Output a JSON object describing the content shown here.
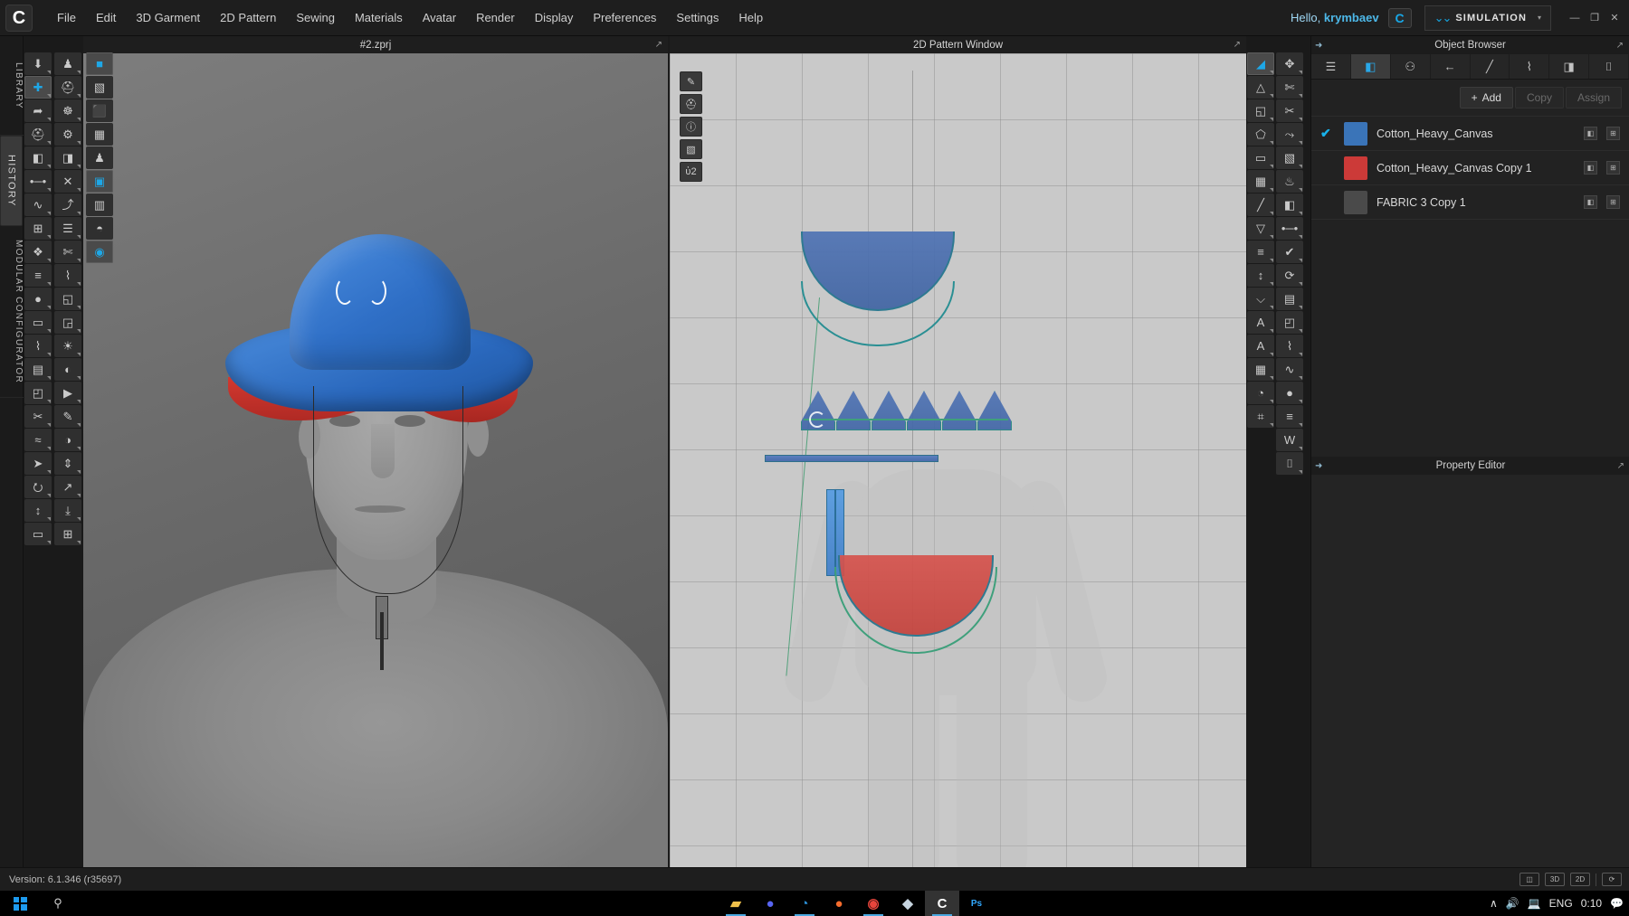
{
  "app": {
    "logo_glyph": "C",
    "greeting_prefix": "Hello, ",
    "greeting_user": "krymbaev",
    "cloud_glyph": "C",
    "mode_label": "SIMULATION",
    "mode_chevron": "⌄⌄",
    "mode_arrow": "▾"
  },
  "menu": {
    "items": [
      {
        "label": "File"
      },
      {
        "label": "Edit"
      },
      {
        "label": "3D Garment"
      },
      {
        "label": "2D Pattern"
      },
      {
        "label": "Sewing"
      },
      {
        "label": "Materials"
      },
      {
        "label": "Avatar"
      },
      {
        "label": "Render"
      },
      {
        "label": "Display"
      },
      {
        "label": "Preferences"
      },
      {
        "label": "Settings"
      },
      {
        "label": "Help"
      }
    ]
  },
  "window_controls": {
    "minimize": "—",
    "restore": "❐",
    "close": "✕"
  },
  "left_tabs": {
    "library": "LIBRARY",
    "history": "HISTORY",
    "modular_configurator": "MODULAR CONFIGURATOR"
  },
  "viewport_3d": {
    "title": "#2.zprj",
    "popout_icon": "↗",
    "hat_logo_text": ""
  },
  "viewport_2d": {
    "title": "2D Pattern Window",
    "popout_icon": "↗"
  },
  "tools_3d": {
    "column_a": [
      {
        "name": "transform-pattern-tool",
        "glyph": "⬇",
        "active": false,
        "accent": false
      },
      {
        "name": "move-tool",
        "glyph": "✚",
        "active": true,
        "accent": true
      },
      {
        "name": "select-mesh-tool",
        "glyph": "➦",
        "active": false,
        "accent": false
      },
      {
        "name": "fold-arrangement-tool",
        "glyph": "⛑",
        "active": false,
        "accent": false
      },
      {
        "name": "segment-sewing-tool",
        "glyph": "◧",
        "active": false,
        "accent": false
      },
      {
        "name": "free-sewing-tool",
        "glyph": "•─•",
        "active": false,
        "accent": false
      },
      {
        "name": "edit-sewing-tool",
        "glyph": "∿",
        "active": false,
        "accent": false
      },
      {
        "name": "pin-tool",
        "glyph": "⊞",
        "active": false,
        "accent": false
      },
      {
        "name": "tack-tool",
        "glyph": "❖",
        "active": false,
        "accent": false
      },
      {
        "name": "zipper-tool",
        "glyph": "≡",
        "active": false,
        "accent": false
      },
      {
        "name": "button-tool",
        "glyph": "●",
        "active": false,
        "accent": false
      },
      {
        "name": "buttonhole-tool",
        "glyph": "▭",
        "active": false,
        "accent": false
      },
      {
        "name": "topstitch-tool",
        "glyph": "⌇",
        "active": false,
        "accent": false
      },
      {
        "name": "fabric-texture-tool",
        "glyph": "▤",
        "active": false,
        "accent": false
      },
      {
        "name": "graphic-tool",
        "glyph": "◰",
        "active": false,
        "accent": false
      },
      {
        "name": "trim-tool",
        "glyph": "✂",
        "active": false,
        "accent": false
      },
      {
        "name": "puckering-tool",
        "glyph": "≈",
        "active": false,
        "accent": false
      },
      {
        "name": "measure-tool",
        "glyph": "➤",
        "active": false,
        "accent": false
      },
      {
        "name": "circumference-tool",
        "glyph": "⭮",
        "active": false,
        "accent": false
      },
      {
        "name": "gravity-tool",
        "glyph": "↕",
        "active": false,
        "accent": false
      },
      {
        "name": "flatten-tool",
        "glyph": "▭",
        "active": false,
        "accent": false
      }
    ],
    "column_b": [
      {
        "name": "avatar-pose-tool",
        "glyph": "♟",
        "active": false,
        "accent": false
      },
      {
        "name": "garment-fit-tool",
        "glyph": "⛑",
        "active": false,
        "accent": false
      },
      {
        "name": "xray-joints-tool",
        "glyph": "☸",
        "active": false,
        "accent": false
      },
      {
        "name": "pin-avatar-tool",
        "glyph": "⚙",
        "active": false,
        "accent": false
      },
      {
        "name": "layer-tool",
        "glyph": "◨",
        "active": false,
        "accent": false
      },
      {
        "name": "strength-map-tool",
        "glyph": "✕",
        "active": false,
        "accent": false
      },
      {
        "name": "fold-tool",
        "glyph": "⤴",
        "active": false,
        "accent": false
      },
      {
        "name": "print-layout-tool",
        "glyph": "☰",
        "active": false,
        "accent": false
      },
      {
        "name": "scissors-tool",
        "glyph": "✄",
        "active": false,
        "accent": false
      },
      {
        "name": "stitch-tool",
        "glyph": "⌇",
        "active": false,
        "accent": false
      },
      {
        "name": "snapshot-tool",
        "glyph": "◱",
        "active": false,
        "accent": false
      },
      {
        "name": "camera-tool",
        "glyph": "◲",
        "active": false,
        "accent": false
      },
      {
        "name": "light-tool",
        "glyph": "☀",
        "active": false,
        "accent": false
      },
      {
        "name": "render-tool",
        "glyph": "◐",
        "active": false,
        "accent": false
      },
      {
        "name": "animation-tool",
        "glyph": "▶",
        "active": false,
        "accent": false
      },
      {
        "name": "texture-paint-tool",
        "glyph": "✎",
        "active": false,
        "accent": false
      },
      {
        "name": "color-tool",
        "glyph": "◑",
        "active": false,
        "accent": false
      },
      {
        "name": "measure-avatar-tool",
        "glyph": "⇕",
        "active": false,
        "accent": false
      },
      {
        "name": "vector-tool",
        "glyph": "↗",
        "active": false,
        "accent": false
      },
      {
        "name": "export-tool",
        "glyph": "⤓",
        "active": false,
        "accent": false
      },
      {
        "name": "grade-tool",
        "glyph": "⊞",
        "active": false,
        "accent": false
      }
    ],
    "column_c": [
      {
        "name": "fabric-preview-swatch",
        "glyph": "■",
        "active": true,
        "accent": true
      },
      {
        "name": "shading-mode-button",
        "glyph": "▧",
        "active": false,
        "accent": false
      },
      {
        "name": "thickness-view-button",
        "glyph": "⬛",
        "active": false,
        "accent": false
      },
      {
        "name": "texture-view-button",
        "glyph": "▦",
        "active": false,
        "accent": false
      },
      {
        "name": "avatar-view-button",
        "glyph": "♟",
        "active": false,
        "accent": false
      },
      {
        "name": "surface-view-button",
        "glyph": "▣",
        "active": true,
        "accent": true
      },
      {
        "name": "mesh-view-button",
        "glyph": "▥",
        "active": false,
        "accent": false
      },
      {
        "name": "shadow-view-button",
        "glyph": "◓",
        "active": false,
        "accent": false
      },
      {
        "name": "render-view-button",
        "glyph": "◉",
        "active": true,
        "accent": true
      }
    ]
  },
  "tools_2d_floating": [
    {
      "name": "edit-pattern-tool",
      "glyph": "✎"
    },
    {
      "name": "show-pattern-outline-tool",
      "glyph": "⛑"
    },
    {
      "name": "show-pattern-info-tool",
      "glyph": "ⓘ"
    },
    {
      "name": "show-texture-tool",
      "glyph": "▧"
    },
    {
      "name": "lock-pattern-tool",
      "glyph": "ὑ2"
    }
  ],
  "tools_2d_right": {
    "column_a": [
      {
        "name": "edit-pattern-select-tool",
        "glyph": "◢",
        "active": true,
        "accent": true
      },
      {
        "name": "edit-curve-point-tool",
        "glyph": "△",
        "active": false,
        "accent": false
      },
      {
        "name": "edit-curvature-tool",
        "glyph": "◱",
        "active": false,
        "accent": false
      },
      {
        "name": "create-polygon-tool",
        "glyph": "⬠",
        "active": false,
        "accent": false
      },
      {
        "name": "create-rectangle-tool",
        "glyph": "▭",
        "active": false,
        "accent": false
      },
      {
        "name": "trace-tool",
        "glyph": "▦",
        "active": false,
        "accent": false
      },
      {
        "name": "internal-line-tool",
        "glyph": "╱",
        "active": false,
        "accent": false
      },
      {
        "name": "dart-tool",
        "glyph": "▽",
        "active": false,
        "accent": false
      },
      {
        "name": "pleat-tool",
        "glyph": "≡",
        "active": false,
        "accent": false
      },
      {
        "name": "grainline-tool",
        "glyph": "↕",
        "active": false,
        "accent": false
      },
      {
        "name": "notch-tool",
        "glyph": "⌵",
        "active": false,
        "accent": false
      },
      {
        "name": "text-tool",
        "glyph": "A",
        "active": false,
        "accent": false
      },
      {
        "name": "annotation-tool",
        "glyph": "A",
        "active": false,
        "accent": false
      },
      {
        "name": "fabric-grid-tool",
        "glyph": "▦",
        "active": false,
        "accent": false
      },
      {
        "name": "pattern-3d-tool",
        "glyph": "◔",
        "active": false,
        "accent": false
      },
      {
        "name": "measure-2d-tool",
        "glyph": "⌗",
        "active": false,
        "accent": false
      }
    ],
    "column_b": [
      {
        "name": "move-pattern-tool",
        "glyph": "✥",
        "active": false,
        "accent": false
      },
      {
        "name": "cut-sew-tool",
        "glyph": "✄",
        "active": false,
        "accent": false
      },
      {
        "name": "slash-spread-tool",
        "glyph": "✂",
        "active": false,
        "accent": false
      },
      {
        "name": "fold-seam-tool",
        "glyph": "⤳",
        "active": false,
        "accent": false
      },
      {
        "name": "seam-allowance-tool",
        "glyph": "▧",
        "active": false,
        "accent": false
      },
      {
        "name": "iron-tool",
        "glyph": "♨",
        "active": false,
        "accent": false
      },
      {
        "name": "segment-sewing-2d-tool",
        "glyph": "◧",
        "active": false,
        "accent": false
      },
      {
        "name": "free-sewing-2d-tool",
        "glyph": "•─•",
        "active": false,
        "accent": false
      },
      {
        "name": "check-sewing-tool",
        "glyph": "✔",
        "active": false,
        "accent": false
      },
      {
        "name": "auto-sewing-tool",
        "glyph": "⟳",
        "active": false,
        "accent": false
      },
      {
        "name": "texture-2d-tool",
        "glyph": "▤",
        "active": false,
        "accent": false
      },
      {
        "name": "graphic-2d-tool",
        "glyph": "◰",
        "active": false,
        "accent": false
      },
      {
        "name": "stitch-2d-tool",
        "glyph": "⌇",
        "active": false,
        "accent": false
      },
      {
        "name": "topstitch-2d-tool",
        "glyph": "∿",
        "active": false,
        "accent": false
      },
      {
        "name": "button-2d-tool",
        "glyph": "●",
        "active": false,
        "accent": false
      },
      {
        "name": "zipper-2d-tool",
        "glyph": "≡",
        "active": false,
        "accent": false
      },
      {
        "name": "grade-rule-tool",
        "glyph": "W",
        "active": false,
        "accent": false
      },
      {
        "name": "ruler-tool",
        "glyph": "⌷",
        "active": false,
        "accent": false
      }
    ]
  },
  "object_browser": {
    "title": "Object Browser",
    "pin_icon": "➜",
    "popout_icon": "↗",
    "tabs": [
      {
        "name": "tab-list-view",
        "icon": "☰",
        "selected": false
      },
      {
        "name": "tab-fabric",
        "icon": "◧",
        "selected": true
      },
      {
        "name": "tab-button",
        "icon": "⚇",
        "selected": false
      },
      {
        "name": "tab-zipper",
        "icon": "←",
        "selected": false
      },
      {
        "name": "tab-topstitch",
        "icon": "╱",
        "selected": false
      },
      {
        "name": "tab-stitch",
        "icon": "⌇",
        "selected": false
      },
      {
        "name": "tab-trim",
        "icon": "◨",
        "selected": false
      },
      {
        "name": "tab-measure",
        "icon": "⌷",
        "selected": false
      }
    ],
    "actions": {
      "add_label": "Add",
      "add_icon": "+",
      "copy_label": "Copy",
      "assign_label": "Assign"
    },
    "items": [
      {
        "name": "Cotton_Heavy_Canvas",
        "color": "#3a74b8",
        "checked": true,
        "check_glyph": "✔",
        "mini_icons": [
          "◧",
          "⊞"
        ]
      },
      {
        "name": "Cotton_Heavy_Canvas Copy 1",
        "color": "#cc3a38",
        "checked": false,
        "check_glyph": "",
        "mini_icons": [
          "◧",
          "⊞"
        ]
      },
      {
        "name": "FABRIC 3 Copy 1",
        "color": "#4a4a4a",
        "checked": false,
        "check_glyph": "",
        "mini_icons": [
          "◧",
          "⊞"
        ]
      }
    ]
  },
  "property_editor": {
    "title": "Property Editor",
    "pin_icon": "➜",
    "popout_icon": "↗"
  },
  "status_bar": {
    "version_text": "Version: 6.1.346 (r35697)",
    "buttons": [
      {
        "name": "split-view-button",
        "label": "◫"
      },
      {
        "name": "view-3d-button",
        "label": "3D"
      },
      {
        "name": "view-2d-button",
        "label": "2D"
      },
      {
        "name": "reset-view-button",
        "label": "⟳"
      }
    ]
  },
  "taskbar": {
    "search_icon": "⚲",
    "apps": [
      {
        "name": "file-explorer-icon",
        "glyph": "▰",
        "color": "#f0c14b",
        "active": false,
        "running": true
      },
      {
        "name": "discord-icon",
        "glyph": "●",
        "color": "#5865f2",
        "active": false,
        "running": false
      },
      {
        "name": "edge-icon",
        "glyph": "◔",
        "color": "#2b8fd6",
        "active": false,
        "running": true
      },
      {
        "name": "origin-icon",
        "glyph": "●",
        "color": "#f56c2d",
        "active": false,
        "running": false
      },
      {
        "name": "chrome-icon",
        "glyph": "◉",
        "color": "#e8453c",
        "active": false,
        "running": true
      },
      {
        "name": "steam-icon",
        "glyph": "◆",
        "color": "#c7d5e0",
        "active": false,
        "running": false
      },
      {
        "name": "clo3d-icon",
        "glyph": "C",
        "color": "#ffffff",
        "active": true,
        "running": true
      },
      {
        "name": "photoshop-icon",
        "glyph": "Ps",
        "color": "#31a8ff",
        "active": false,
        "running": false
      }
    ],
    "tray": {
      "chevron": "∧",
      "volume": "ὐa",
      "network": "▣",
      "language": "ENG",
      "time": "0:10",
      "notification": "▭"
    }
  },
  "pattern_pieces": {
    "gore_count": 6,
    "strip_count": 2
  }
}
